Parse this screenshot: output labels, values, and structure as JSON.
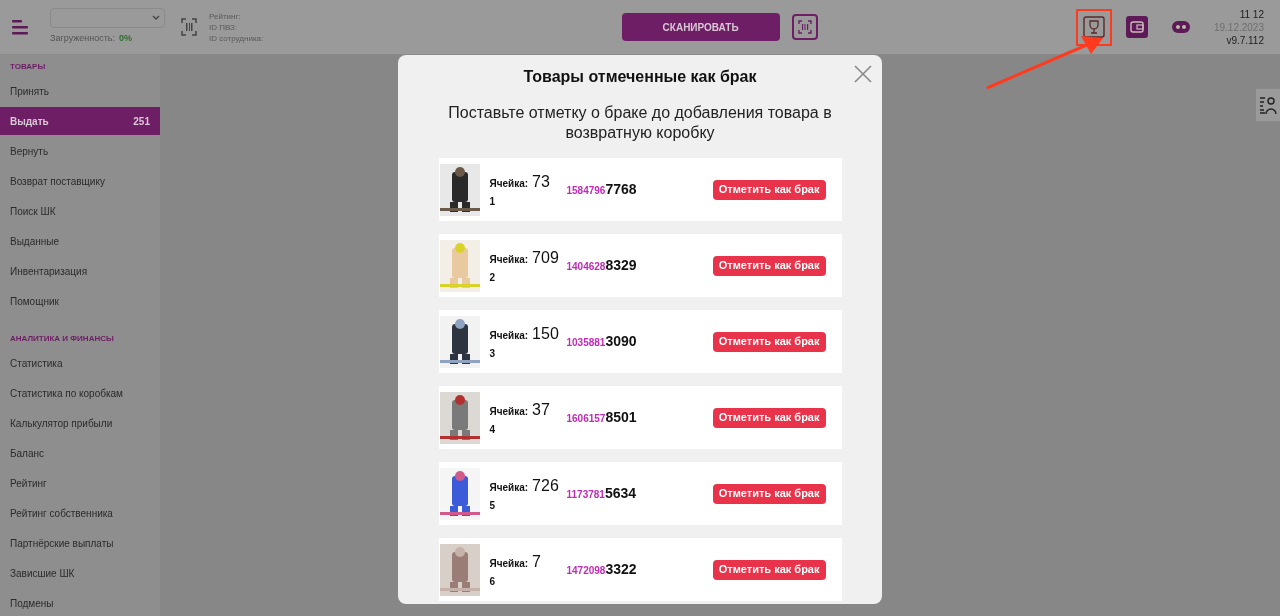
{
  "header": {
    "workload_label": "Загруженность:",
    "workload_value": "0%",
    "rating_lines": [
      "Рейтинг:",
      "ID ПВЗ:",
      "ID сотрудника:"
    ],
    "scan_button": "СКАНИРОВАТЬ",
    "time": "11 12",
    "date": "19.12.2023",
    "version": "v9.7.112"
  },
  "sidebar": {
    "sections": [
      {
        "title": "ТОВАРЫ",
        "items": [
          {
            "label": "Принять",
            "selected": false
          },
          {
            "label": "Выдать",
            "selected": true,
            "count": "251"
          },
          {
            "label": "Вернуть",
            "selected": false
          },
          {
            "label": "Возврат поставщику",
            "selected": false
          },
          {
            "label": "Поиск ШК",
            "selected": false
          },
          {
            "label": "Выданные",
            "selected": false
          },
          {
            "label": "Инвентаризация",
            "selected": false
          },
          {
            "label": "Помощник",
            "selected": false
          }
        ]
      },
      {
        "title": "АНАЛИТИКА И ФИНАНСЫ",
        "items": [
          {
            "label": "Статистика",
            "selected": false
          },
          {
            "label": "Статистика по коробкам",
            "selected": false
          },
          {
            "label": "Калькулятор прибыли",
            "selected": false
          },
          {
            "label": "Баланс",
            "selected": false
          },
          {
            "label": "Рейтинг",
            "selected": false
          },
          {
            "label": "Рейтинг собственника",
            "selected": false
          },
          {
            "label": "Партнёрские выплаты",
            "selected": false
          },
          {
            "label": "Зависшие ШК",
            "selected": false
          },
          {
            "label": "Подмены",
            "selected": false
          }
        ]
      }
    ]
  },
  "modal": {
    "title": "Товары отмеченные как брак",
    "subtitle": "Поставьте отметку о браке до добавления товара в возвратную коробку",
    "rows": [
      {
        "cell_label": "Ячейка:",
        "cell": "73",
        "index": "1",
        "code_prefix": "1584796",
        "code_suffix": "7768",
        "button": "Отметить как брак"
      },
      {
        "cell_label": "Ячейка:",
        "cell": "709",
        "index": "2",
        "code_prefix": "1404628",
        "code_suffix": "8329",
        "button": "Отметить как брак"
      },
      {
        "cell_label": "Ячейка:",
        "cell": "150",
        "index": "3",
        "code_prefix": "1035881",
        "code_suffix": "3090",
        "button": "Отметить как брак"
      },
      {
        "cell_label": "Ячейка:",
        "cell": "37",
        "index": "4",
        "code_prefix": "1606157",
        "code_suffix": "8501",
        "button": "Отметить как брак"
      },
      {
        "cell_label": "Ячейка:",
        "cell": "726",
        "index": "5",
        "code_prefix": "1173781",
        "code_suffix": "5634",
        "button": "Отметить как брак"
      },
      {
        "cell_label": "Ячейка:",
        "cell": "7",
        "index": "6",
        "code_prefix": "1472098",
        "code_suffix": "3322",
        "button": "Отметить как брак"
      }
    ]
  }
}
